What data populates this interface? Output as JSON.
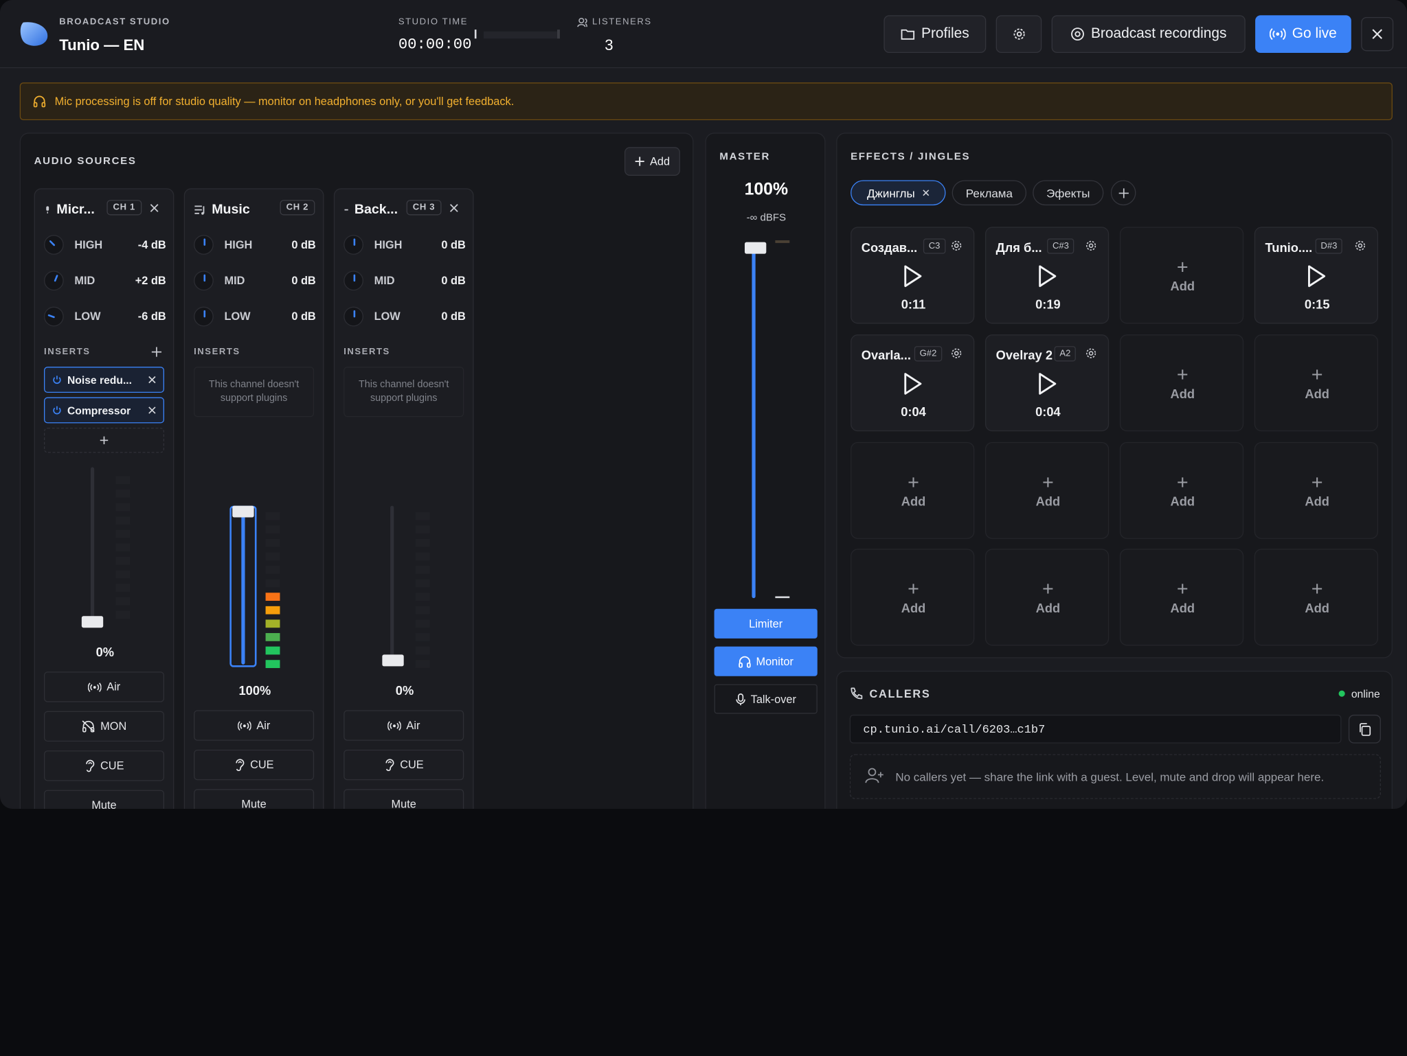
{
  "header": {
    "kicker": "BROADCAST STUDIO",
    "title": "Tunio — EN",
    "studio_time_label": "STUDIO TIME",
    "studio_time": "00:00:00",
    "listeners_label": "LISTENERS",
    "listeners": "3",
    "profiles": "Profiles",
    "recordings": "Broadcast recordings",
    "go_live": "Go live"
  },
  "banner": "Mic processing is off for studio quality — monitor on headphones only, or you'll get feedback.",
  "sources": {
    "title": "AUDIO SOURCES",
    "add": "Add",
    "inserts_label": "INSERTS",
    "no_plugins": "This channel doesn't support plugins",
    "channels": [
      {
        "name": "Micr...",
        "tag": "CH 1",
        "eq": [
          {
            "band": "HIGH",
            "value": "-4 dB"
          },
          {
            "band": "MID",
            "value": "+2 dB"
          },
          {
            "band": "LOW",
            "value": "-6 dB"
          }
        ],
        "plugins": [
          "Noise redu...",
          "Compressor"
        ],
        "level": "0%",
        "fader": 0,
        "buttons": [
          "Air",
          "MON",
          "CUE",
          "Mute"
        ]
      },
      {
        "name": "Music",
        "tag": "CH 2",
        "eq": [
          {
            "band": "HIGH",
            "value": "0 dB"
          },
          {
            "band": "MID",
            "value": "0 dB"
          },
          {
            "band": "LOW",
            "value": "0 dB"
          }
        ],
        "level": "100%",
        "fader": 1,
        "buttons": [
          "Air",
          "CUE",
          "Mute"
        ]
      },
      {
        "name": "Back...",
        "tag": "CH 3",
        "eq": [
          {
            "band": "HIGH",
            "value": "0 dB"
          },
          {
            "band": "MID",
            "value": "0 dB"
          },
          {
            "band": "LOW",
            "value": "0 dB"
          }
        ],
        "level": "0%",
        "fader": 0,
        "buttons": [
          "Air",
          "CUE",
          "Mute"
        ]
      }
    ]
  },
  "master": {
    "title": "MASTER",
    "level": "100%",
    "dbfs": "-∞ dBFS",
    "fader": 1,
    "limiter": "Limiter",
    "monitor": "Monitor",
    "talkover": "Talk-over"
  },
  "effects": {
    "title": "EFFECTS / JINGLES",
    "tabs": [
      "Джинглы",
      "Реклама",
      "Эфекты"
    ],
    "add_label": "Add",
    "pads": [
      {
        "title": "Создав...",
        "key": "C3",
        "duration": "0:11"
      },
      {
        "title": "Для б...",
        "key": "C#3",
        "duration": "0:19"
      },
      {
        "title": "",
        "key": "",
        "duration": ""
      },
      {
        "title": "Tunio....",
        "key": "D#3",
        "duration": "0:15"
      },
      {
        "title": "Ovarla...",
        "key": "G#2",
        "duration": "0:04"
      },
      {
        "title": "Ovelray 2",
        "key": "A2",
        "duration": "0:04"
      }
    ]
  },
  "callers": {
    "title": "CALLERS",
    "status": "online",
    "link": "cp.tunio.ai/call/6203…c1b7",
    "empty": "No callers yet — share the link with a guest. Level, mute and drop will appear here."
  },
  "colors": {
    "accent": "#3b82f6",
    "warning": "#f2b02f",
    "online": "#22c55e"
  }
}
